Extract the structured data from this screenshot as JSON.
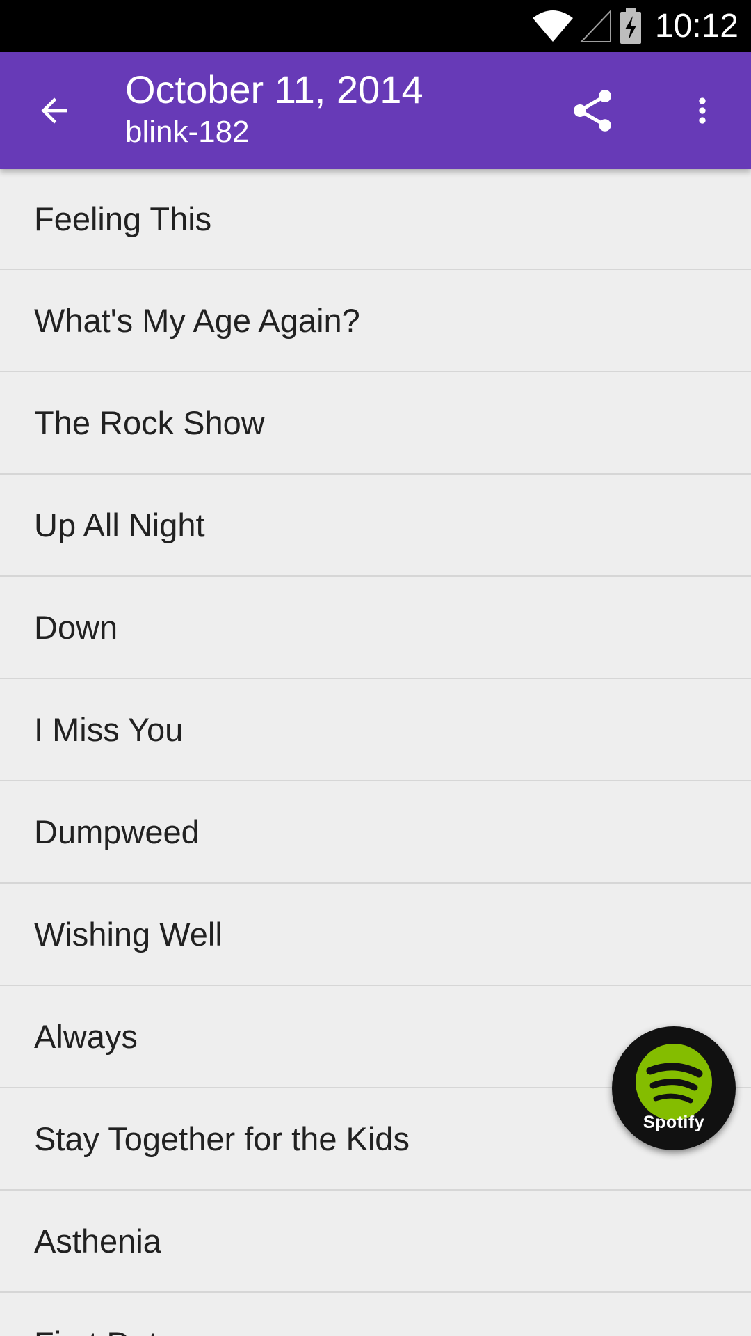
{
  "status_bar": {
    "time": "10:12",
    "icons": [
      "wifi-icon",
      "cell-signal-icon",
      "battery-charging-icon"
    ]
  },
  "app_bar": {
    "title": "October 11, 2014",
    "subtitle": "blink-182",
    "background_color": "#673ab7",
    "icons": [
      "arrow-back-icon",
      "share-icon",
      "more-vert-icon"
    ]
  },
  "songs": [
    {
      "title": "Feeling This"
    },
    {
      "title": "What's My Age Again?"
    },
    {
      "title": "The Rock Show"
    },
    {
      "title": "Up All Night"
    },
    {
      "title": "Down"
    },
    {
      "title": "I Miss You"
    },
    {
      "title": "Dumpweed"
    },
    {
      "title": "Wishing Well"
    },
    {
      "title": "Always"
    },
    {
      "title": "Stay Together for the Kids"
    },
    {
      "title": "Asthenia"
    },
    {
      "title": "First Date"
    }
  ],
  "fab": {
    "label": "Spotify",
    "icon": "spotify-icon",
    "logo_color": "#84bd00"
  }
}
